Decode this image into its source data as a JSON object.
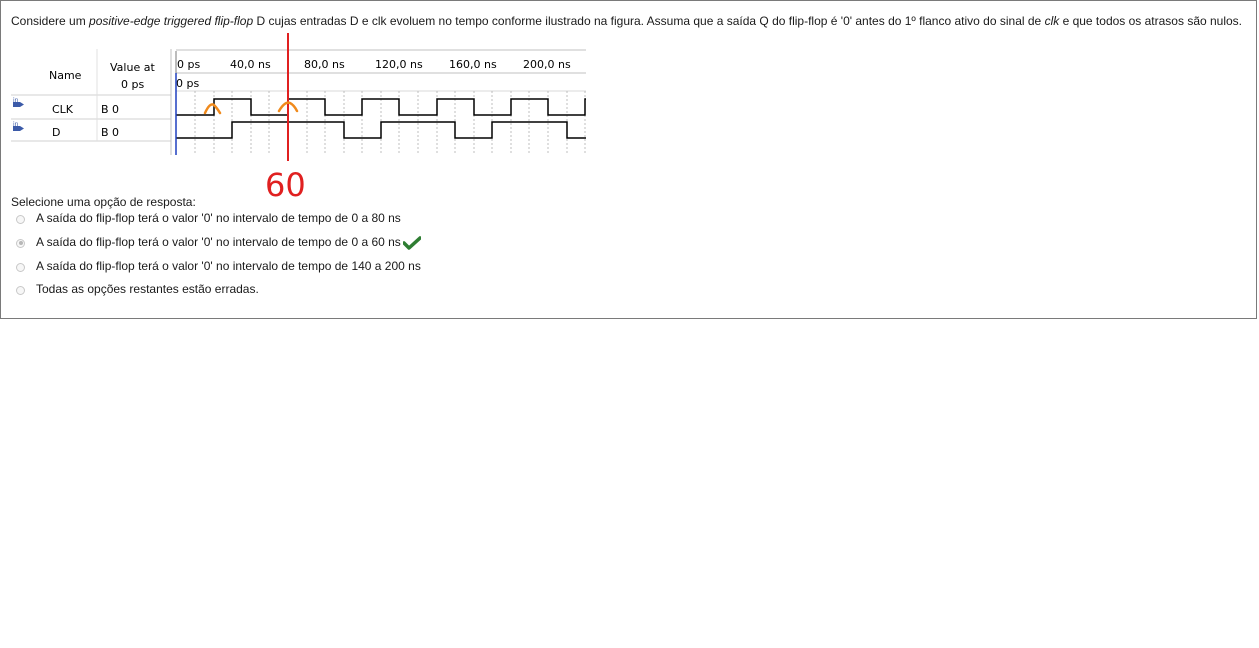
{
  "question": {
    "part1": "Considere um ",
    "em1": "positive-edge triggered flip-flop",
    "part2": " D cujas entradas D e clk evoluem no tempo conforme ilustrado na figura. Assuma que a saída Q do flip-flop é '0' antes do 1º flanco ativo do sinal de ",
    "em2": "clk",
    "part3": " e que todos os atrasos são nulos."
  },
  "waveform": {
    "header_name": "Name",
    "header_value_line1": "Value at",
    "header_value_line2": "0 ps",
    "time_labels": [
      "0 ps",
      "40,0 ns",
      "80,0 ns",
      "120,0 ns",
      "160,0 ns",
      "200,0 ns"
    ],
    "cursor_label": "0 ps",
    "signals": [
      {
        "type_badge": "in",
        "name": "CLK",
        "value": "B 0"
      },
      {
        "type_badge": "in",
        "name": "D",
        "value": "B 0"
      }
    ],
    "colors": {
      "signal": "#000000",
      "cursor": "#1f3fbf",
      "badge": "#3b5aa8",
      "grid": "#b0b0b0"
    }
  },
  "annotation": {
    "handwritten_text": "60",
    "colors": {
      "marker": "#e02020",
      "edge_marks": "#f08a1c"
    }
  },
  "prompt": "Selecione uma opção de resposta:",
  "options": [
    {
      "label": "A saída do flip-flop terá o valor '0' no intervalo de tempo de 0 a 80 ns",
      "selected": false
    },
    {
      "label": "A saída do flip-flop terá o valor '0' no intervalo de tempo de 0 a 60 ns",
      "selected": true,
      "correct": true
    },
    {
      "label": "A saída do flip-flop terá o valor '0' no intervalo de tempo de 140 a 200 ns",
      "selected": false
    },
    {
      "label": "Todas as opções restantes estão erradas.",
      "selected": false
    }
  ],
  "check_color": "#2e7d32"
}
